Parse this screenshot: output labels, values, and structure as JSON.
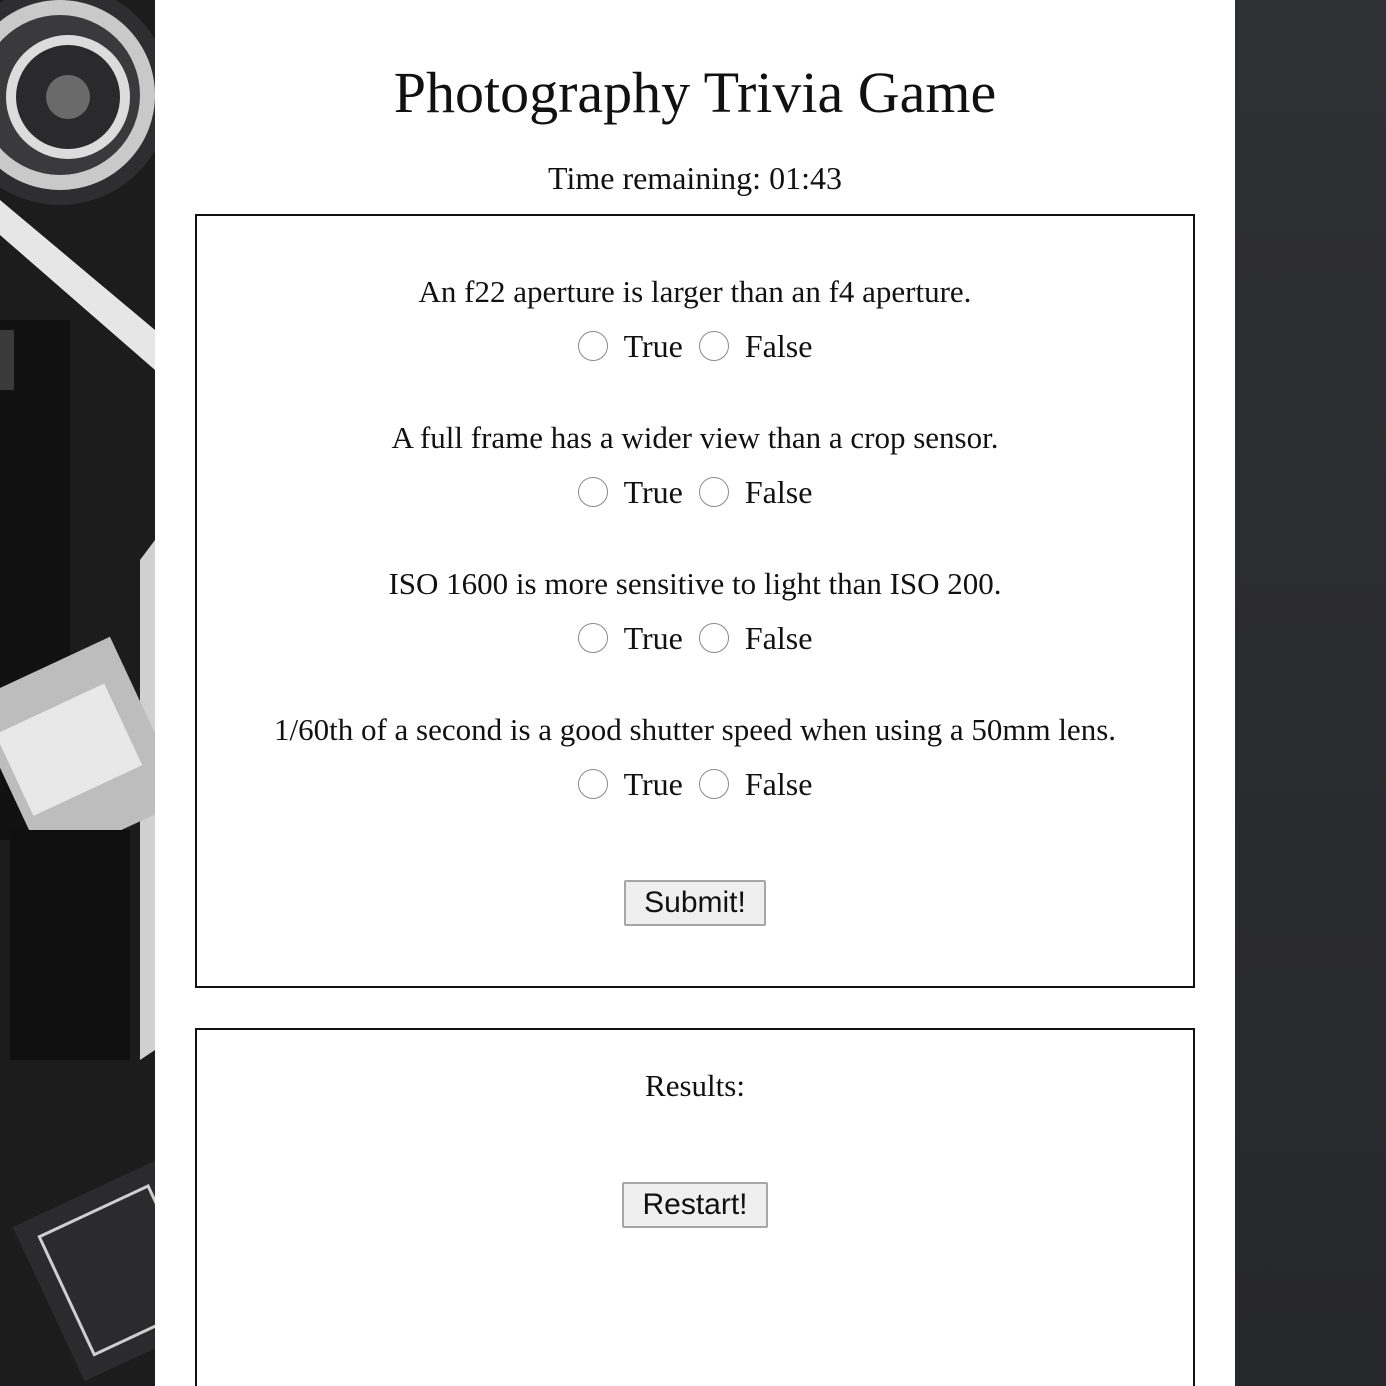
{
  "page": {
    "title": "Photography Trivia Game",
    "timer_label": "Time remaining: 01:43"
  },
  "quiz": {
    "questions": [
      {
        "text": "An f22 aperture is larger than an f4 aperture.",
        "options": [
          "True",
          "False"
        ]
      },
      {
        "text": "A full frame has a wider view than a crop sensor.",
        "options": [
          "True",
          "False"
        ]
      },
      {
        "text": "ISO 1600 is more sensitive to light than ISO 200.",
        "options": [
          "True",
          "False"
        ]
      },
      {
        "text": "1/60th of a second is a good shutter speed when using a 50mm lens.",
        "options": [
          "True",
          "False"
        ]
      }
    ],
    "submit_label": "Submit!"
  },
  "results": {
    "label": "Results:",
    "restart_label": "Restart!"
  },
  "background": {
    "image": "camera-photo-background-icon",
    "page_color": "#ffffff",
    "side_color": "#2a2b2e"
  }
}
